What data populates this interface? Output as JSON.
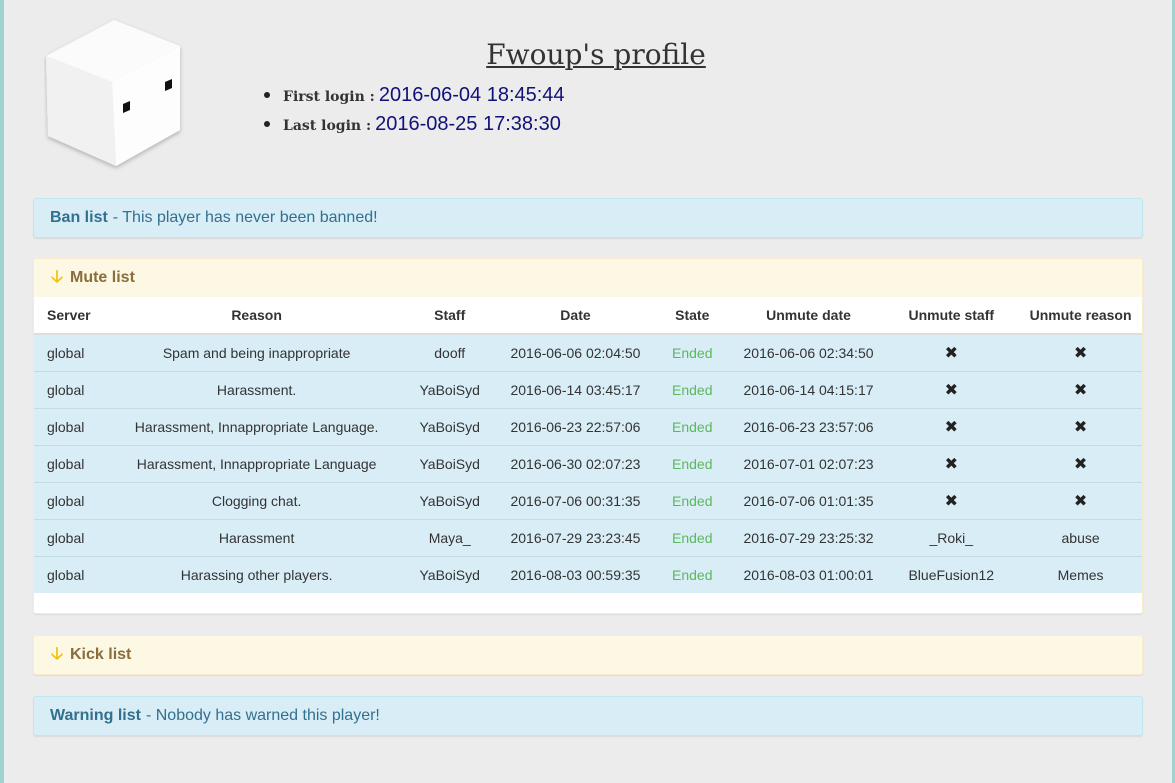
{
  "profile": {
    "title": "Fwoup's profile",
    "first_login_label": "First login :",
    "first_login_value": "2016-06-04 18:45:44",
    "last_login_label": "Last login :",
    "last_login_value": "2016-08-25 17:38:30"
  },
  "ban_panel": {
    "title": "Ban list",
    "message": "- This player has never been banned!"
  },
  "mute_panel": {
    "title": "Mute list",
    "columns": [
      "Server",
      "Reason",
      "Staff",
      "Date",
      "State",
      "Unmute date",
      "Unmute staff",
      "Unmute reason"
    ],
    "rows": [
      {
        "server": "global",
        "reason": "Spam and being inappropriate",
        "staff": "dooff",
        "date": "2016-06-06 02:04:50",
        "state": "Ended",
        "unmute_date": "2016-06-06 02:34:50",
        "unmute_staff": "✖",
        "unmute_reason": "✖"
      },
      {
        "server": "global",
        "reason": "Harassment.",
        "staff": "YaBoiSyd",
        "date": "2016-06-14 03:45:17",
        "state": "Ended",
        "unmute_date": "2016-06-14 04:15:17",
        "unmute_staff": "✖",
        "unmute_reason": "✖"
      },
      {
        "server": "global",
        "reason": "Harassment, Innappropriate Language.",
        "staff": "YaBoiSyd",
        "date": "2016-06-23 22:57:06",
        "state": "Ended",
        "unmute_date": "2016-06-23 23:57:06",
        "unmute_staff": "✖",
        "unmute_reason": "✖"
      },
      {
        "server": "global",
        "reason": "Harassment, Innappropriate Language",
        "staff": "YaBoiSyd",
        "date": "2016-06-30 02:07:23",
        "state": "Ended",
        "unmute_date": "2016-07-01 02:07:23",
        "unmute_staff": "✖",
        "unmute_reason": "✖"
      },
      {
        "server": "global",
        "reason": "Clogging chat.",
        "staff": "YaBoiSyd",
        "date": "2016-07-06 00:31:35",
        "state": "Ended",
        "unmute_date": "2016-07-06 01:01:35",
        "unmute_staff": "✖",
        "unmute_reason": "✖"
      },
      {
        "server": "global",
        "reason": "Harassment",
        "staff": "Maya_",
        "date": "2016-07-29 23:23:45",
        "state": "Ended",
        "unmute_date": "2016-07-29 23:25:32",
        "unmute_staff": "_Roki_",
        "unmute_reason": "abuse"
      },
      {
        "server": "global",
        "reason": "Harassing other players.",
        "staff": "YaBoiSyd",
        "date": "2016-08-03 00:59:35",
        "state": "Ended",
        "unmute_date": "2016-08-03 01:00:01",
        "unmute_staff": "BlueFusion12",
        "unmute_reason": "Memes"
      }
    ]
  },
  "kick_panel": {
    "title": "Kick list"
  },
  "warning_panel": {
    "title": "Warning list",
    "message": "- Nobody has warned this player!"
  },
  "icons": {
    "collapse": "arrow-down-icon",
    "none": "x-mark-icon",
    "avatar": "cube-avatar"
  },
  "colors": {
    "state_ended": "#5cb85c",
    "info_bg": "#d9edf7",
    "warn_bg": "#fcf8e3",
    "login_value": "#11117a"
  }
}
